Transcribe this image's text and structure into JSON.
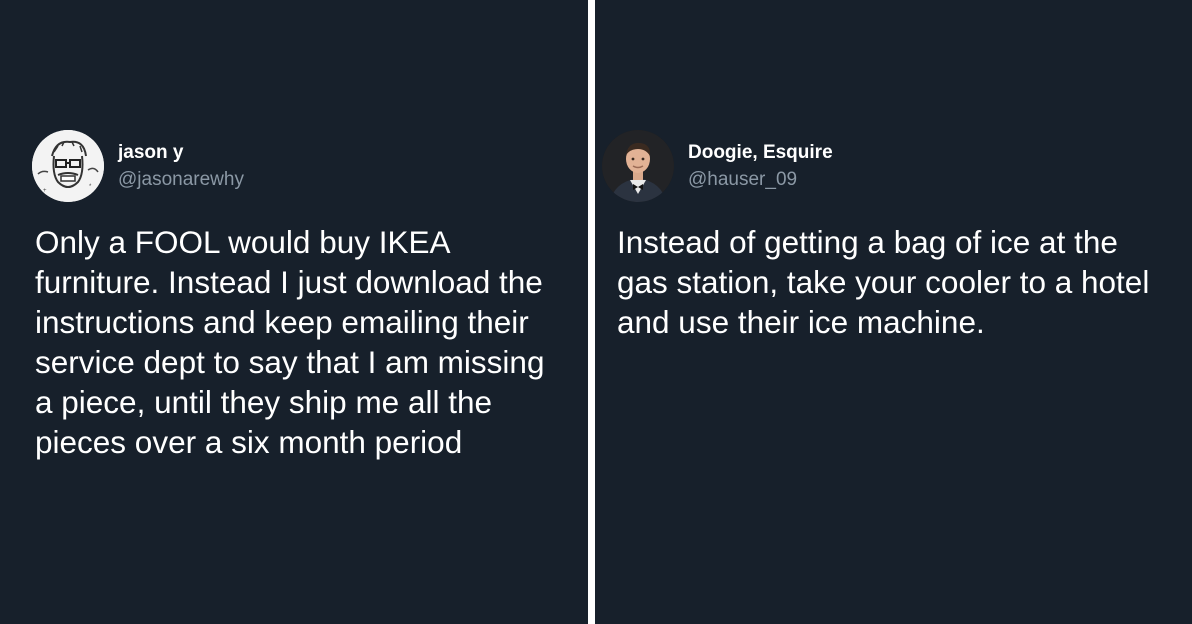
{
  "tweets": [
    {
      "display_name": "jason y",
      "handle": "@jasonarewhy",
      "avatar_icon": "cartoon-face-avatar-icon",
      "text": "Only a FOOL would buy IKEA furniture. Instead I just download the instructions and keep emailing their service dept to say that I am missing a piece, until they ship me all the pieces over a six month period"
    },
    {
      "display_name": "Doogie, Esquire",
      "handle": "@hauser_09",
      "avatar_icon": "profile-photo-avatar-icon",
      "text": "Instead of getting a bag of ice at the gas station, take your cooler to a hotel and use their ice machine."
    }
  ],
  "colors": {
    "background": "#17202b",
    "divider": "#ffffff",
    "name": "#ffffff",
    "handle": "#8b98a5",
    "text": "#ffffff"
  }
}
